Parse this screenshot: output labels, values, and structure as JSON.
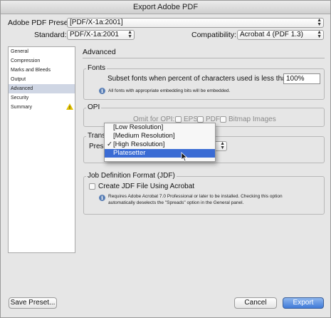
{
  "window": {
    "title": "Export Adobe PDF"
  },
  "preset": {
    "label": "Adobe PDF Preset:",
    "value": "[PDF/X-1a:2001]"
  },
  "standard": {
    "label": "Standard:",
    "value": "PDF/X-1a:2001"
  },
  "compatibility": {
    "label": "Compatibility:",
    "value": "Acrobat 4 (PDF 1.3)"
  },
  "sidebar": {
    "items": [
      {
        "label": "General"
      },
      {
        "label": "Compression"
      },
      {
        "label": "Marks and Bleeds"
      },
      {
        "label": "Output"
      },
      {
        "label": "Advanced",
        "selected": true
      },
      {
        "label": "Security"
      },
      {
        "label": "Summary",
        "warning": true
      }
    ]
  },
  "panel": {
    "title": "Advanced",
    "fonts": {
      "title": "Fonts",
      "subset_label": "Subset fonts when percent of characters used is less than:",
      "subset_value": "100%",
      "note": "All fonts with appropriate embedding bits will be embedded."
    },
    "opi": {
      "title": "OPI",
      "omit_label": "Omit for OPI:",
      "eps": "EPS",
      "pdf": "PDF",
      "bitmap": "Bitmap Images"
    },
    "transparency": {
      "title": "Transp",
      "preset_label": "Preset"
    },
    "jdf": {
      "title": "Job Definition Format (JDF)",
      "checkbox_label": "Create JDF File Using Acrobat",
      "note_line1": "Requires Adobe Acrobat 7.0 Professional or later to be installed. Checking this option",
      "note_line2": "automatically deselects the \"Spreads\" option in the General panel."
    }
  },
  "dropdown": {
    "items": [
      {
        "label": "[Low Resolution]",
        "checked": false,
        "highlight": false
      },
      {
        "label": "[Medium Resolution]",
        "checked": false,
        "highlight": false
      },
      {
        "label": "[High Resolution]",
        "checked": true,
        "highlight": false
      },
      {
        "label": "Platesetter",
        "checked": false,
        "highlight": true
      }
    ]
  },
  "buttons": {
    "save_preset": "Save Preset...",
    "cancel": "Cancel",
    "export": "Export"
  }
}
